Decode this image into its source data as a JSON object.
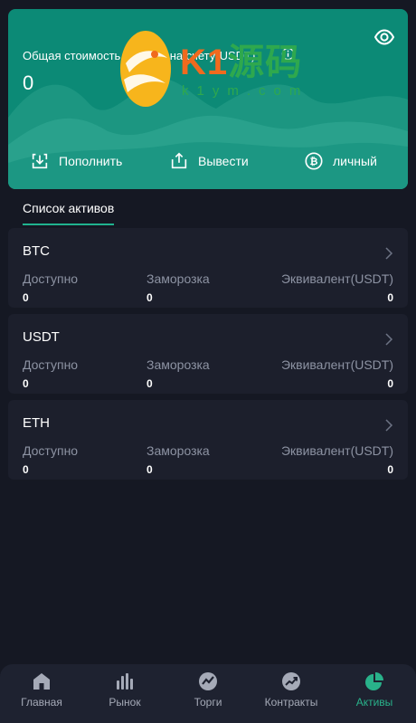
{
  "header": {
    "total_label": "Общая стоимость активов на счету(USDT)",
    "total_value": "0",
    "actions": {
      "deposit_label": "Пополнить",
      "withdraw_label": "Вывести",
      "personal_label": "личный"
    }
  },
  "watermark": {
    "brand": "K1",
    "brand_cn": "源码",
    "url": "k1ym.com"
  },
  "section": {
    "title": "Список активов"
  },
  "assets": [
    {
      "name": "BTC",
      "available_label": "Доступно",
      "frozen_label": "Заморозка",
      "equivalent_label": "Эквивалент(USDT)",
      "available": "0",
      "frozen": "0",
      "equivalent": "0"
    },
    {
      "name": "USDT",
      "available_label": "Доступно",
      "frozen_label": "Заморозка",
      "equivalent_label": "Эквивалент(USDT)",
      "available": "0",
      "frozen": "0",
      "equivalent": "0"
    },
    {
      "name": "ETH",
      "available_label": "Доступно",
      "frozen_label": "Заморозка",
      "equivalent_label": "Эквивалент(USDT)",
      "available": "0",
      "frozen": "0",
      "equivalent": "0"
    }
  ],
  "nav": {
    "items": [
      {
        "label": "Главная",
        "icon": "home-icon"
      },
      {
        "label": "Рынок",
        "icon": "market-bars-icon"
      },
      {
        "label": "Торги",
        "icon": "trade-icon"
      },
      {
        "label": "Контракты",
        "icon": "contracts-trend-icon"
      },
      {
        "label": "Активы",
        "icon": "assets-pie-icon"
      }
    ],
    "active_index": 4
  },
  "colors": {
    "background": "#151823",
    "header_card": "#0c8a76",
    "card": "#1c1f2c",
    "accent": "#29b28a",
    "muted_text": "#8d93a3"
  }
}
